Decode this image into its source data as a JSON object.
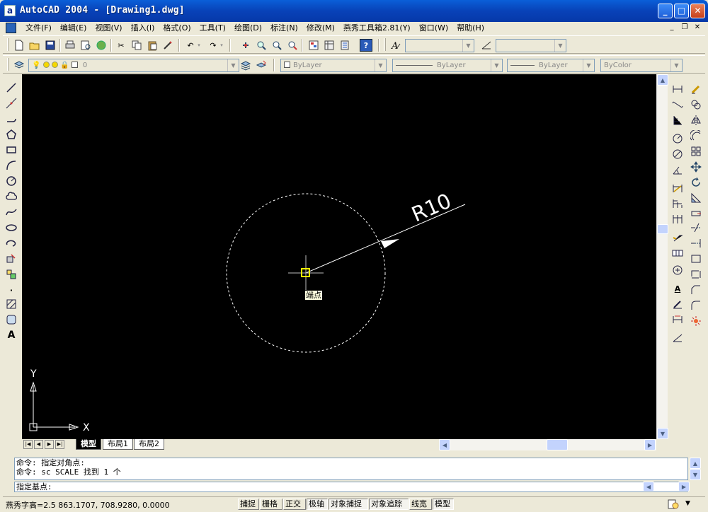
{
  "window": {
    "title": "AutoCAD 2004 - [Drawing1.dwg]",
    "app_icon_letter": "a",
    "minimize": "_",
    "maximize": "□",
    "close": "✕"
  },
  "menu": {
    "items": [
      "文件(F)",
      "编辑(E)",
      "视图(V)",
      "插入(I)",
      "格式(O)",
      "工具(T)",
      "绘图(D)",
      "标注(N)",
      "修改(M)",
      "燕秀工具箱2.81(Y)",
      "窗口(W)",
      "帮助(H)"
    ],
    "mdi_minimize": "_",
    "mdi_restore": "❐",
    "mdi_close": "✕"
  },
  "toolbars": {
    "layer_value": "0",
    "color": "ByLayer",
    "linetype": "ByLayer",
    "lineweight": "ByLayer",
    "plotstyle": "ByColor"
  },
  "canvas": {
    "dimension_text": "R10",
    "tooltip": "端点",
    "ucs_x": "X",
    "ucs_y": "Y"
  },
  "tabs": {
    "model": "模型",
    "layout1": "布局1",
    "layout2": "布局2"
  },
  "command": {
    "history": [
      "命令: 指定对角点:",
      "命令: sc SCALE 找到 1 个"
    ],
    "prompt": "指定基点:"
  },
  "status": {
    "coords": "燕秀字高=2.5  863.1707,  708.9280,  0.0000",
    "buttons": [
      {
        "label": "捕捉",
        "on": false
      },
      {
        "label": "栅格",
        "on": false
      },
      {
        "label": "正交",
        "on": false
      },
      {
        "label": "极轴",
        "on": true
      },
      {
        "label": "对象捕捉",
        "on": true
      },
      {
        "label": "对象追踪",
        "on": true
      },
      {
        "label": "线宽",
        "on": false
      },
      {
        "label": "模型",
        "on": true
      }
    ]
  },
  "colors": {
    "canvas_bg": "#000000",
    "titlebar": "#0842B8",
    "dimension": "#FFFFFF",
    "snap_marker": "#FFFF00"
  }
}
